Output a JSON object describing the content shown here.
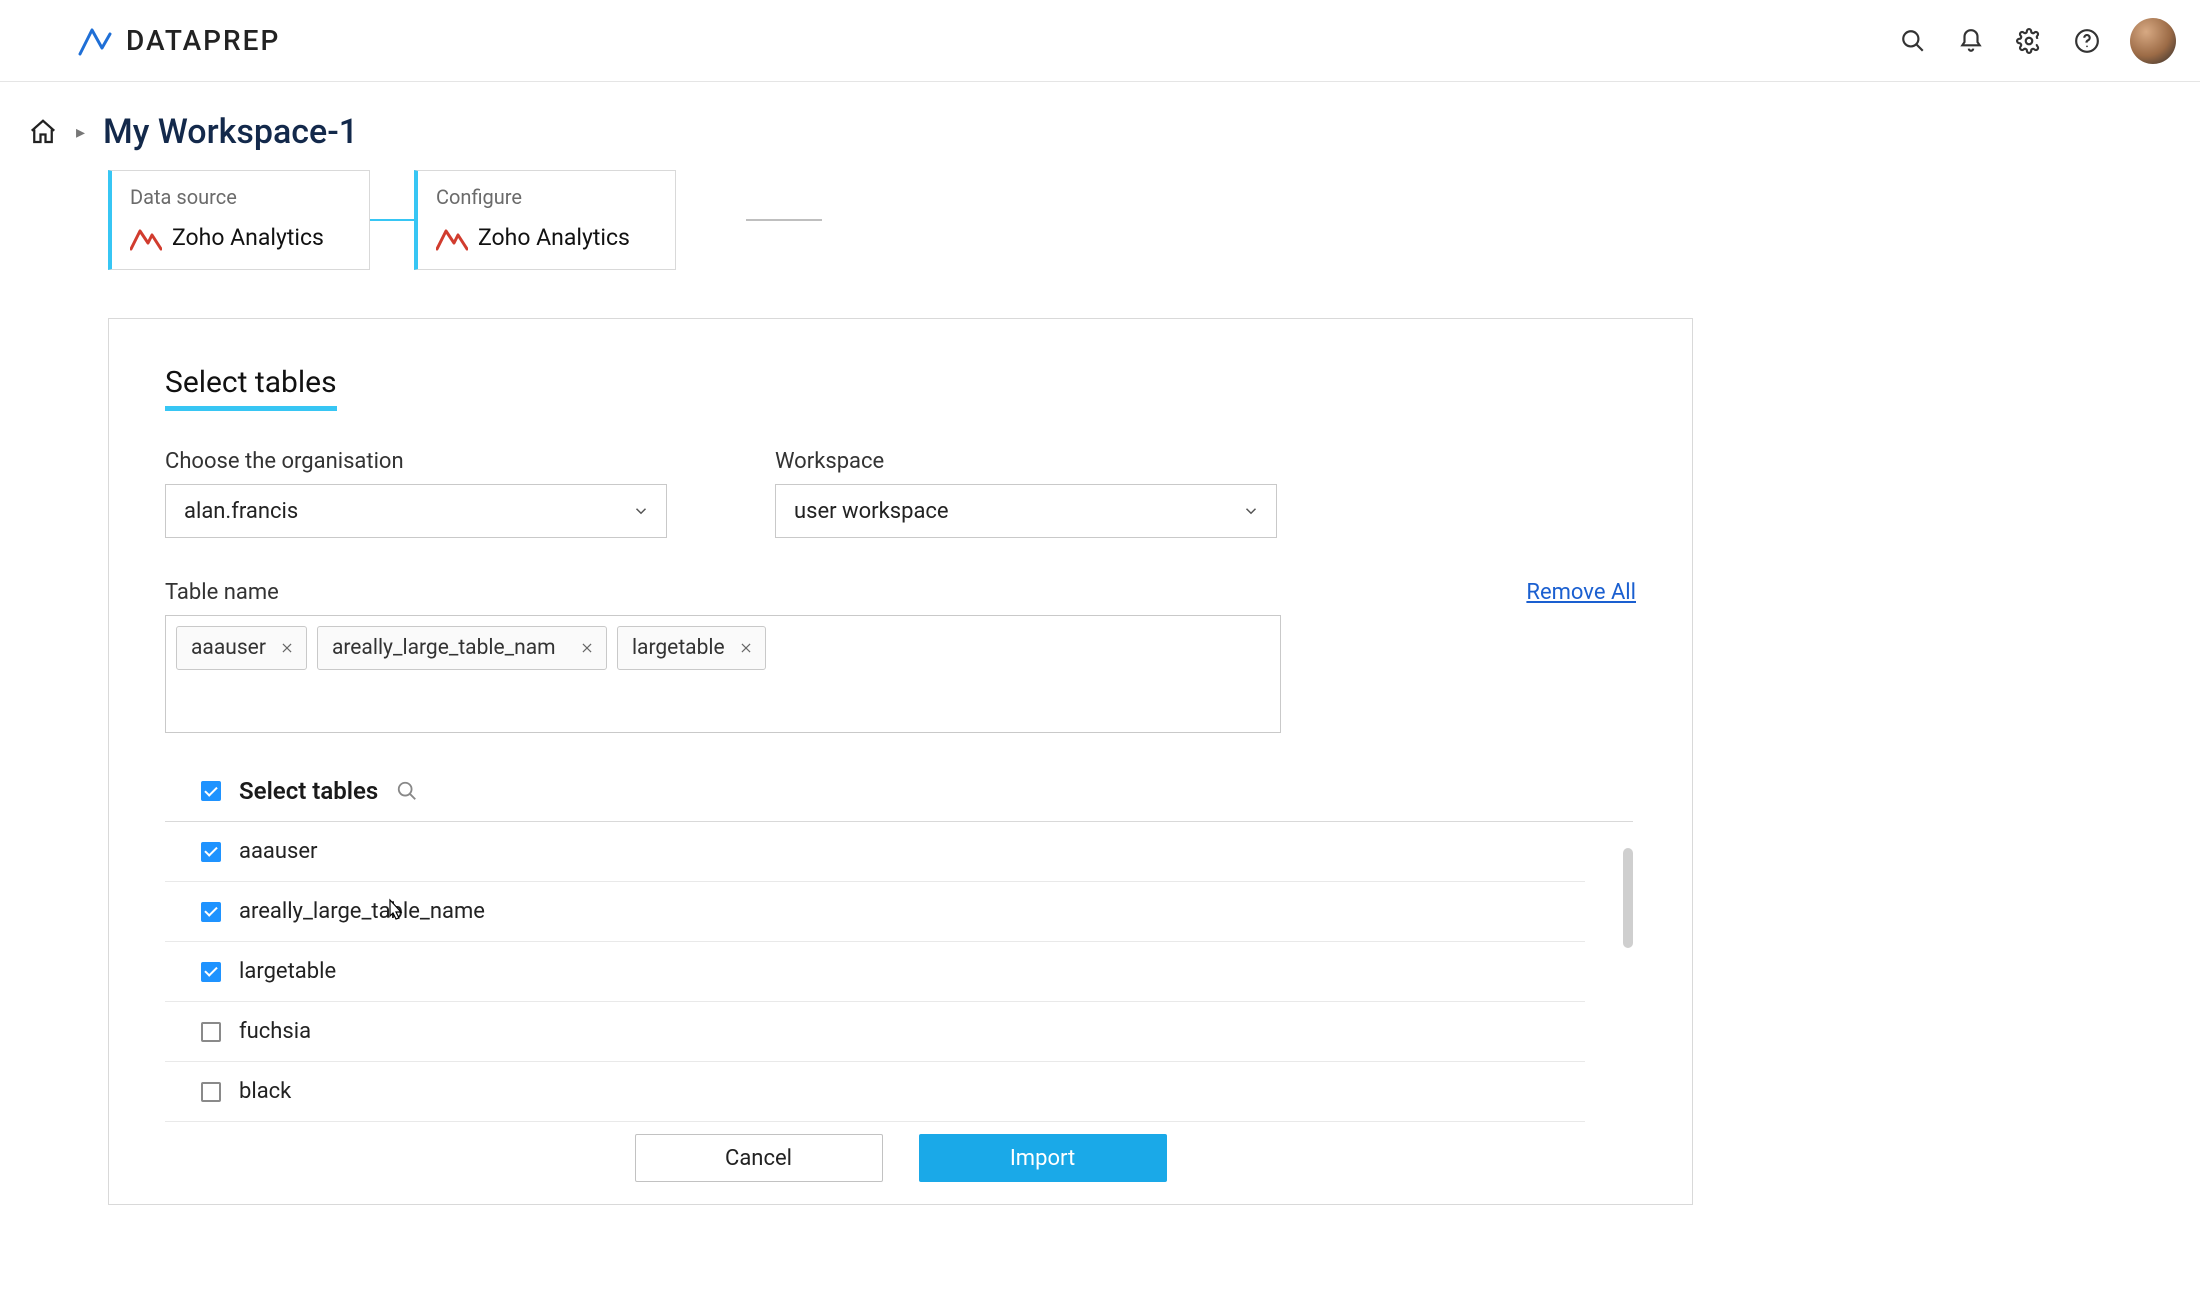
{
  "brand": "DATAPREP",
  "breadcrumb": {
    "title": "My Workspace-1"
  },
  "steps": {
    "card1": {
      "label": "Data source",
      "source": "Zoho Analytics"
    },
    "card2": {
      "label": "Configure",
      "source": "Zoho Analytics"
    }
  },
  "panel": {
    "title": "Select tables",
    "org_label": "Choose the organisation",
    "org_value": "alan.francis",
    "ws_label": "Workspace",
    "ws_value": "user workspace",
    "table_name_label": "Table name",
    "remove_all": "Remove All",
    "chips": [
      "aaauser",
      "areally_large_table_nam",
      "largetable"
    ],
    "list_title": "Select tables",
    "tables": [
      {
        "name": "aaauser",
        "checked": true
      },
      {
        "name": "areally_large_table_name",
        "checked": true
      },
      {
        "name": "largetable",
        "checked": true
      },
      {
        "name": "fuchsia",
        "checked": false
      },
      {
        "name": "black",
        "checked": false
      }
    ],
    "cancel": "Cancel",
    "import": "Import"
  }
}
